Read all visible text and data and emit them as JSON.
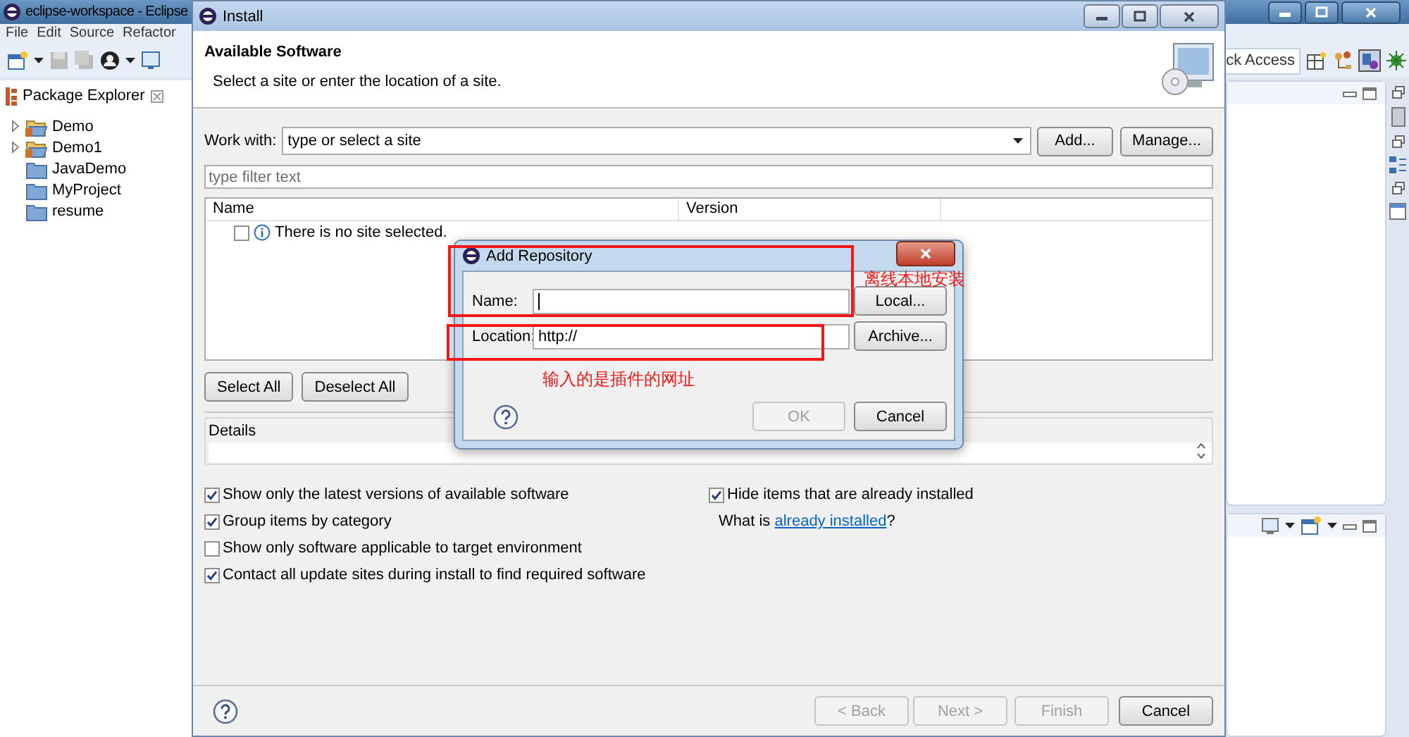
{
  "eclipse": {
    "title": "eclipse-workspace - Eclipse",
    "menu": [
      "File",
      "Edit",
      "Source",
      "Refactor"
    ],
    "quick_access": "ck Access",
    "package_explorer": {
      "title": "Package Explorer",
      "projects": [
        {
          "name": "Demo",
          "kind": "java"
        },
        {
          "name": "Demo1",
          "kind": "java"
        },
        {
          "name": "JavaDemo",
          "kind": "folder"
        },
        {
          "name": "MyProject",
          "kind": "folder"
        },
        {
          "name": "resume",
          "kind": "folder"
        }
      ]
    }
  },
  "install": {
    "title": "Install",
    "header_title": "Available Software",
    "header_subtitle": "Select a site or enter the location of a site.",
    "work_with": {
      "label": "Work with:",
      "placeholder": "type or select a site"
    },
    "add_button": "Add...",
    "manage_button": "Manage...",
    "filter": {
      "placeholder": "type filter text"
    },
    "table": {
      "columns": [
        "Name",
        "Version"
      ],
      "rows": [
        {
          "text": "There is no site selected.",
          "checked": false
        }
      ]
    },
    "select_all": "Select All",
    "deselect_all": "Deselect All",
    "details_label": "Details",
    "options": [
      {
        "label": "Show only the latest versions of available software",
        "checked": true
      },
      {
        "label": "Group items by category",
        "checked": true
      },
      {
        "label": "Show only software applicable to target environment",
        "checked": false
      },
      {
        "label": "Contact all update sites during install to find required software",
        "checked": true
      }
    ],
    "hide_installed": {
      "label": "Hide items that are already installed",
      "checked": true
    },
    "what_is": {
      "before": "What is ",
      "link": "already installed",
      "after": "?"
    },
    "buttons": [
      {
        "label": "< Back",
        "disabled": true
      },
      {
        "label": "Next >",
        "disabled": true
      },
      {
        "label": "Finish",
        "disabled": true
      },
      {
        "label": "Cancel",
        "disabled": false
      }
    ]
  },
  "add_repository": {
    "title": "Add Repository",
    "name_label": "Name:",
    "location_label": "Location:",
    "location_value": "http://",
    "local_button": "Local...",
    "archive_button": "Archive...",
    "buttons": [
      {
        "label": "OK",
        "disabled": true
      },
      {
        "label": "Cancel",
        "disabled": false
      }
    ]
  },
  "annotations": [
    {
      "text": "离线本地安装"
    },
    {
      "text": "输入的是插件的网址"
    }
  ]
}
